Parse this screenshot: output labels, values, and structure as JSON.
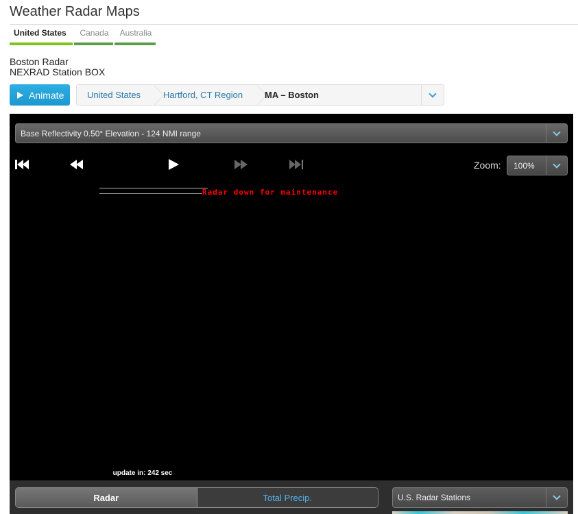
{
  "header": {
    "title": "Weather Radar Maps"
  },
  "country_tabs": [
    {
      "label": "United States",
      "active": true
    },
    {
      "label": "Canada",
      "active": false
    },
    {
      "label": "Australia",
      "active": false
    }
  ],
  "station": {
    "name": "Boston Radar",
    "id_line": "NEXRAD Station BOX"
  },
  "toolbar": {
    "animate_label": "Animate",
    "icon": "play-icon"
  },
  "breadcrumb": [
    {
      "label": "United States",
      "link": true
    },
    {
      "label": "Hartford, CT Region",
      "link": true
    },
    {
      "label": "MA – Boston",
      "link": false
    }
  ],
  "radar": {
    "product_select": "Base Reflectivity 0.50° Elevation - 124 NMI range",
    "controls": [
      {
        "name": "first-frame",
        "icon": "skip-to-start-icon",
        "enabled": true
      },
      {
        "name": "previous-frame",
        "icon": "rewind-icon",
        "enabled": true
      },
      {
        "name": "play",
        "icon": "play-icon",
        "enabled": true
      },
      {
        "name": "next-frame",
        "icon": "fast-forward-icon",
        "enabled": false
      },
      {
        "name": "last-frame",
        "icon": "skip-to-end-icon",
        "enabled": false
      }
    ],
    "zoom_label": "Zoom:",
    "zoom_value": "100%",
    "status_message": "Radar down for maintenance",
    "update_text": "update in: 242 sec"
  },
  "bottom": {
    "layer_tabs": [
      {
        "label": "Radar",
        "active": true
      },
      {
        "label": "Total Precip.",
        "active": false
      }
    ],
    "stations_select": "U.S. Radar Stations"
  },
  "colors": {
    "accent_blue": "#1c98cf",
    "tab_active_green": "#7fc41d",
    "tab_green": "#5a9e4c",
    "alert_red": "#ff0000",
    "link_blue": "#2878a8"
  }
}
